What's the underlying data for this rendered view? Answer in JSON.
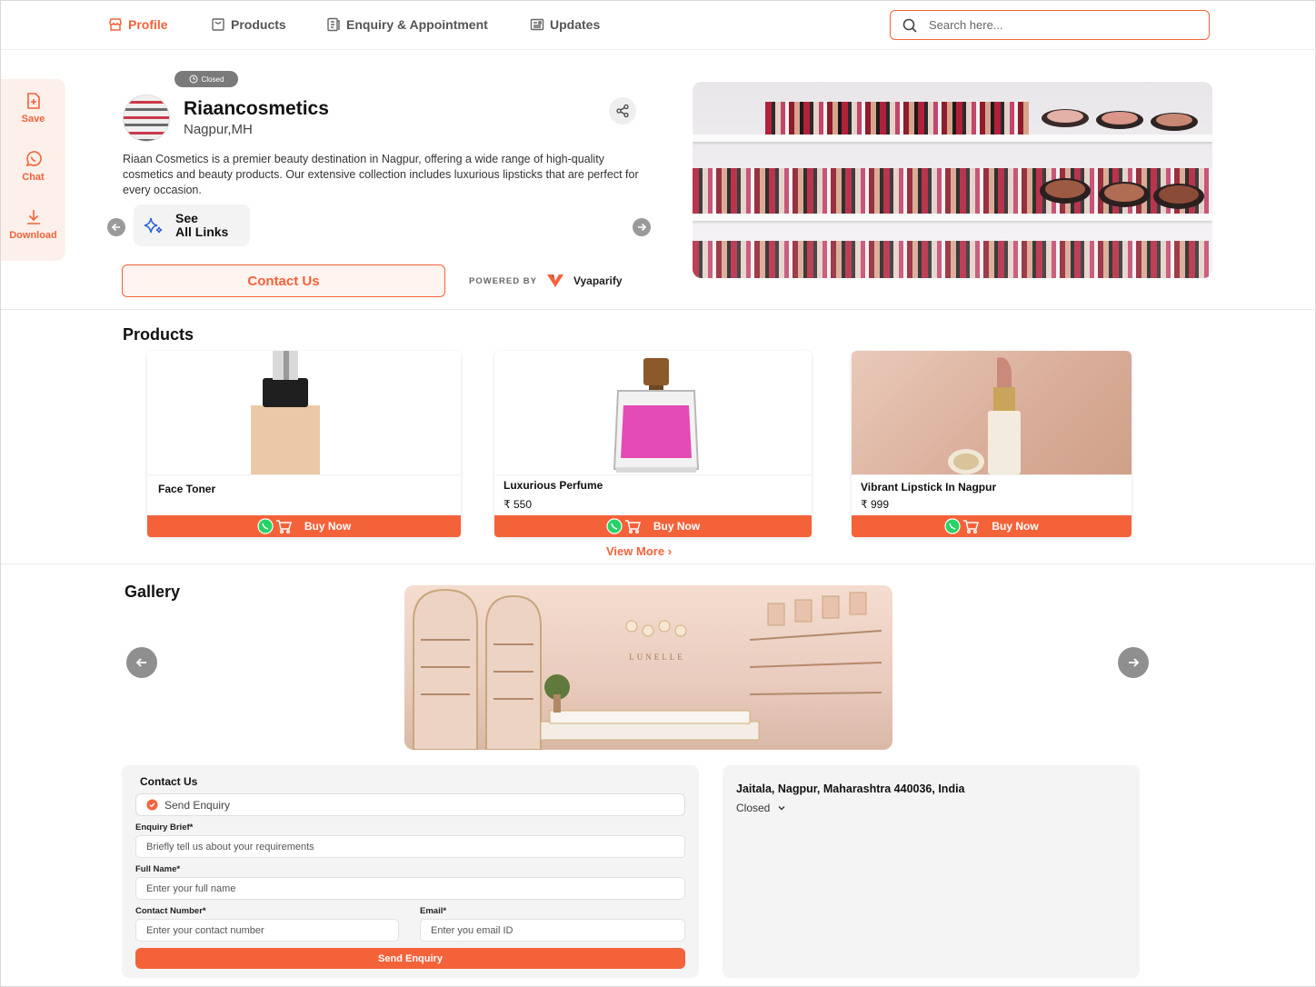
{
  "nav": {
    "profile": "Profile",
    "products": "Products",
    "enquiry": "Enquiry & Appointment",
    "updates": "Updates",
    "search_placeholder": "Search here..."
  },
  "sidebar": {
    "save": "Save",
    "chat": "Chat",
    "download": "Download"
  },
  "business": {
    "status": "Closed",
    "name": "Riaancosmetics",
    "location": "Nagpur,MH",
    "description": "Riaan Cosmetics is a premier beauty destination in Nagpur, offering a wide range of high-quality cosmetics and beauty products. Our extensive collection includes luxurious lipsticks that are perfect for every occasion.",
    "see_links_line1": "See",
    "see_links_line2": "All Links",
    "contact_label": "Contact Us",
    "powered_by": "POWERED BY",
    "powered_brand": "Vyaparify"
  },
  "products": {
    "title": "Products",
    "items": [
      {
        "name": "Face Toner",
        "price": "",
        "buy": "Buy Now"
      },
      {
        "name": "Luxurious Perfume",
        "price": "₹ 550",
        "buy": "Buy Now"
      },
      {
        "name": "Vibrant Lipstick In Nagpur",
        "price": "₹ 999",
        "buy": "Buy Now"
      }
    ],
    "view_more": "View More"
  },
  "gallery": {
    "title": "Gallery",
    "store_sign": "LUNELLE"
  },
  "contact_form": {
    "title": "Contact Us",
    "tab": "Send Enquiry",
    "brief_label": "Enquiry Brief*",
    "brief_placeholder": "Briefly tell us about your requirements",
    "name_label": "Full Name*",
    "name_placeholder": "Enter your full name",
    "phone_label": "Contact Number*",
    "phone_placeholder": "Enter your contact number",
    "email_label": "Email*",
    "email_placeholder": "Enter you email ID",
    "submit": "Send Enquiry"
  },
  "location": {
    "address": "Jaitala, Nagpur, Maharashtra 440036, India",
    "hours_status": "Closed"
  },
  "colors": {
    "accent": "#f4623a",
    "accent_light": "#fdf0ea",
    "panel": "#f4f4f4"
  }
}
